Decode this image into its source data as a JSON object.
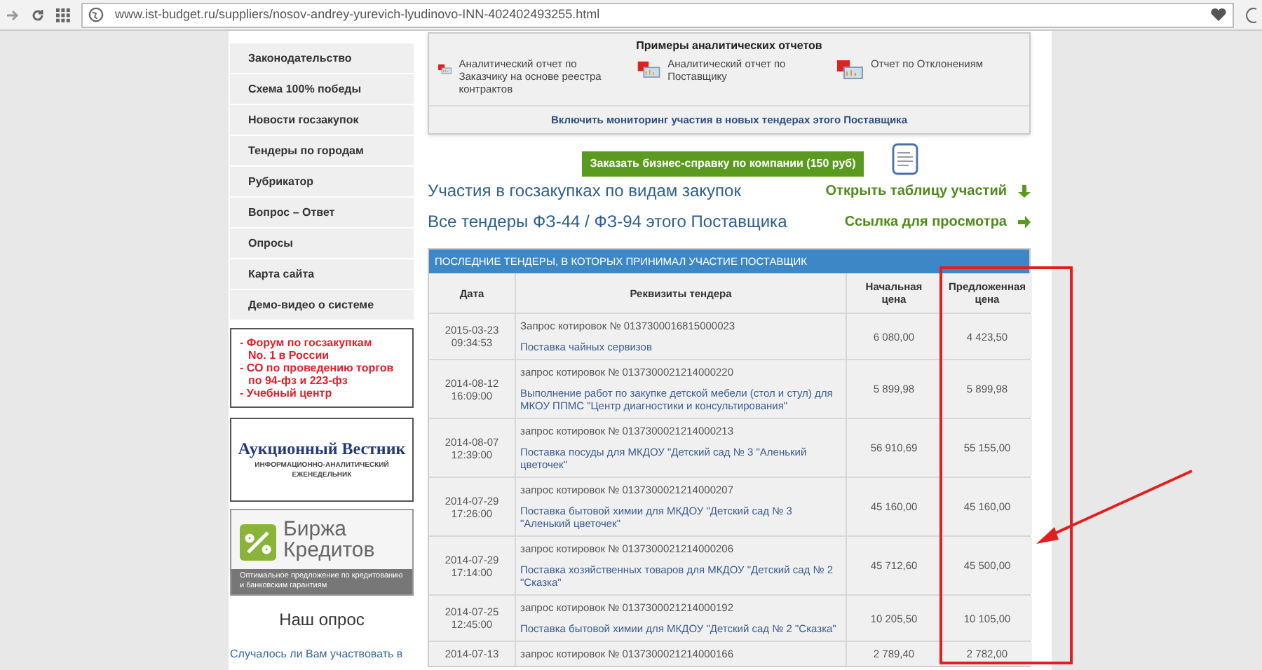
{
  "browser": {
    "url": "www.ist-budget.ru/suppliers/nosov-andrey-yurevich-lyudinovo-INN-402402493255.html"
  },
  "sidebar": {
    "items": [
      {
        "label": "Законодательство"
      },
      {
        "label": "Схема 100% победы"
      },
      {
        "label": "Новости госзакупок"
      },
      {
        "label": "Тендеры по городам"
      },
      {
        "label": "Рубрикатор"
      },
      {
        "label": "Вопрос – Ответ"
      },
      {
        "label": "Опросы"
      },
      {
        "label": "Карта сайта"
      },
      {
        "label": "Демо-видео о системе"
      }
    ],
    "promo_lines": [
      "- Форум по госзакупкам",
      "No. 1 в России",
      "- СО по проведению торгов",
      "по 94-фз и 223-фз",
      "- Учебный центр"
    ],
    "banner_auction": {
      "title": "Аукционный Вестник",
      "subtitle": "ИНФОРМАЦИОННО-АНАЛИТИЧЕСКИЙ ЕЖЕНЕДЕЛЬНИК"
    },
    "banner_credit": {
      "title_1": "Биржа",
      "title_2": "Кредитов",
      "caption": "Оптимальное предложение по кредитованию и банковским гарантиям"
    },
    "poll": {
      "title": "Наш опрос",
      "question": "Случалось ли Вам участвовать в"
    }
  },
  "reports": {
    "title": "Примеры аналитических отчетов",
    "items": [
      {
        "label": "Аналитический отчет по Заказчику на основе реестра контрактов"
      },
      {
        "label": "Аналитический отчет по Поставщику"
      },
      {
        "label": "Отчет по Отклонениям"
      }
    ],
    "monitor_link": "Включить мониторинг участия в новых тендерах этого Поставщика"
  },
  "order_button": "Заказать бизнес-справку по компании (150 руб)",
  "links": [
    {
      "title": "Участия в госзакупках по видам закупок",
      "action": "Открыть таблицу участий",
      "kind": "down"
    },
    {
      "title": "Все тендеры ФЗ-44 / ФЗ-94 этого Поставщика",
      "action": "Ссылка для просмотра",
      "kind": "right"
    }
  ],
  "table": {
    "caption": "ПОСЛЕДНИЕ ТЕНДЕРЫ, В КОТОРЫХ ПРИНИМАЛ УЧАСТИЕ ПОСТАВЩИК",
    "columns": [
      "Дата",
      "Реквизиты тендера",
      "Начальная цена",
      "Предложенная цена"
    ],
    "rows": [
      {
        "date": "2015-03-23",
        "time": "09:34:53",
        "number": "Запрос котировок № 0137300016815000023",
        "subject": "Поставка чайных сервизов",
        "start_price": "6 080,00",
        "offered_price": "4 423,50"
      },
      {
        "date": "2014-08-12",
        "time": "16:09:00",
        "number": "запрос котировок № 0137300021214000220",
        "subject": "Выполнение работ по закупке детской мебели (стол и стул) для МКОУ ППМС \"Центр диагностики и консультирования\"",
        "start_price": "5 899,98",
        "offered_price": "5 899,98"
      },
      {
        "date": "2014-08-07",
        "time": "12:39:00",
        "number": "запрос котировок № 0137300021214000213",
        "subject": "Поставка посуды для МКДОУ \"Детский сад № 3 \"Аленький цветочек\"",
        "start_price": "56 910,69",
        "offered_price": "55 155,00"
      },
      {
        "date": "2014-07-29",
        "time": "17:26:00",
        "number": "запрос котировок № 0137300021214000207",
        "subject": "Поставка бытовой химии для МКДОУ \"Детский сад № 3 \"Аленький цветочек\"",
        "start_price": "45 160,00",
        "offered_price": "45 160,00"
      },
      {
        "date": "2014-07-29",
        "time": "17:14:00",
        "number": "запрос котировок № 0137300021214000206",
        "subject": "Поставка хозяйственных товаров для МКДОУ \"Детский сад № 2 \"Сказка\"",
        "start_price": "45 712,60",
        "offered_price": "45 500,00"
      },
      {
        "date": "2014-07-25",
        "time": "12:45:00",
        "number": "запрос котировок № 0137300021214000192",
        "subject": "Поставка бытовой химии для МКДОУ \"Детский сад № 2 \"Сказка\"",
        "start_price": "10 205,50",
        "offered_price": "10 105,00"
      },
      {
        "date": "2014-07-13",
        "number": "запрос котировок № 0137300021214000166",
        "start_price": "2 789,40",
        "offered_price": "2 782,00"
      }
    ]
  }
}
